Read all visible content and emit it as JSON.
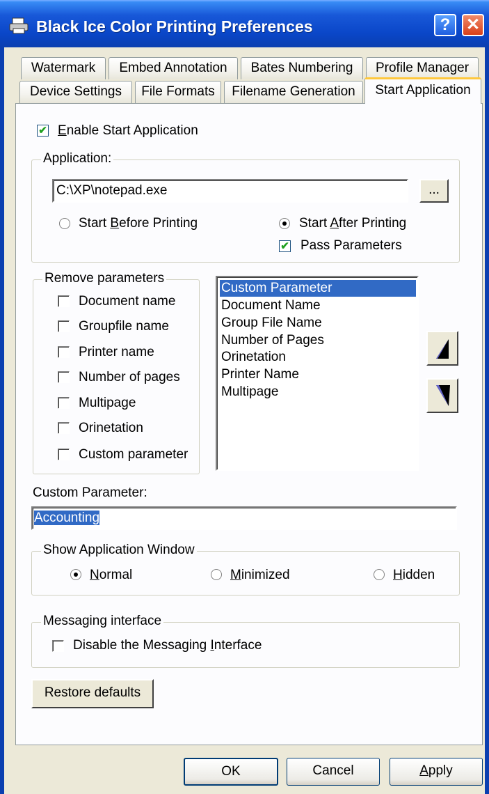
{
  "window": {
    "title": "Black Ice Color Printing Preferences",
    "help_label": "?",
    "close_label": "✕"
  },
  "tabs": {
    "row1": [
      "Watermark",
      "Embed Annotation",
      "Bates Numbering",
      "Profile Manager"
    ],
    "row2": [
      "Device Settings",
      "File Formats",
      "Filename Generation",
      "Start Application"
    ],
    "active": "Start Application"
  },
  "start_app": {
    "enable_pre": "",
    "enable_key": "E",
    "enable_post": "nable Start Application",
    "enable_checked": true,
    "application_group": "Application:",
    "application_path": "C:\\XP\\notepad.exe",
    "browse_label": "...",
    "before_pre": "Start ",
    "before_key": "B",
    "before_post": "efore Printing",
    "after_pre": "Start ",
    "after_key": "A",
    "after_post": "fter Printing",
    "pass_label": "Pass Parameters",
    "pass_checked": true
  },
  "remove_params": {
    "title": "Remove parameters",
    "items": [
      "Document name",
      "Groupfile name",
      "Printer name",
      "Number of pages",
      "Multipage",
      "Orinetation",
      "Custom parameter"
    ]
  },
  "param_list": {
    "items": [
      "Custom Parameter",
      "Document Name",
      "Group File Name",
      "Number of Pages",
      "Orinetation",
      "Printer Name",
      "Multipage"
    ],
    "selected": "Custom Parameter"
  },
  "custom_parameter": {
    "label": "Custom Parameter:",
    "value": "Accounting"
  },
  "show_window": {
    "title": "Show Application Window",
    "normal_key": "N",
    "normal_post": "ormal",
    "min_key": "M",
    "min_post": "inimized",
    "hidden_key": "H",
    "hidden_post": "idden",
    "selected": "Normal"
  },
  "messaging": {
    "title": "Messaging interface",
    "disable_pre": "Disable the Messaging ",
    "disable_key": "I",
    "disable_post": "nterface"
  },
  "buttons": {
    "restore": "Restore defaults",
    "ok": "OK",
    "cancel": "Cancel",
    "apply_key": "A",
    "apply_post": "pply"
  },
  "colors": {
    "titlebar": "#0a46c8",
    "selection": "#316ac5",
    "tab_highlight": "#ffc83c",
    "checkmark": "#21a121"
  }
}
